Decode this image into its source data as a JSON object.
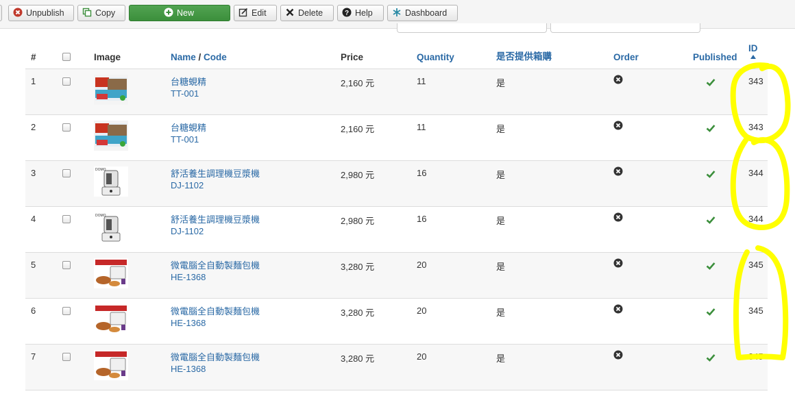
{
  "toolbar": {
    "unpublish": "Unpublish",
    "copy": "Copy",
    "new": "New",
    "edit": "Edit",
    "delete": "Delete",
    "help": "Help",
    "dashboard": "Dashboard"
  },
  "table": {
    "headers": {
      "num": "#",
      "image": "Image",
      "name": "Name",
      "sep": " / ",
      "code": "Code",
      "price": "Price",
      "quantity": "Quantity",
      "box": "是否提供箱購",
      "order": "Order",
      "published": "Published",
      "id": "ID"
    },
    "rows": [
      {
        "num": "1",
        "name": "台糖蜆精",
        "code": "TT-001",
        "price": "2,160 元",
        "quantity": "11",
        "box": "是",
        "id": "343",
        "image": "clam-essence-box"
      },
      {
        "num": "2",
        "name": "台糖蜆精",
        "code": "TT-001",
        "price": "2,160 元",
        "quantity": "11",
        "box": "是",
        "id": "343",
        "image": "clam-essence-box"
      },
      {
        "num": "3",
        "name": "舒活養生調理機豆漿機",
        "code": "DJ-1102",
        "price": "2,980 元",
        "quantity": "16",
        "box": "是",
        "id": "344",
        "image": "blender"
      },
      {
        "num": "4",
        "name": "舒活養生調理機豆漿機",
        "code": "DJ-1102",
        "price": "2,980 元",
        "quantity": "16",
        "box": "是",
        "id": "344",
        "image": "blender"
      },
      {
        "num": "5",
        "name": "微電腦全自動製麵包機",
        "code": "HE-1368",
        "price": "3,280 元",
        "quantity": "20",
        "box": "是",
        "id": "345",
        "image": "bread-maker"
      },
      {
        "num": "6",
        "name": "微電腦全自動製麵包機",
        "code": "HE-1368",
        "price": "3,280 元",
        "quantity": "20",
        "box": "是",
        "id": "345",
        "image": "bread-maker"
      },
      {
        "num": "7",
        "name": "微電腦全自動製麵包機",
        "code": "HE-1368",
        "price": "3,280 元",
        "quantity": "20",
        "box": "是",
        "id": "345",
        "image": "bread-maker"
      }
    ]
  },
  "colors": {
    "link": "#2a69a5",
    "new_button": "#46a046",
    "published_check": "#3c8f3c",
    "highlight": "#ffff00"
  },
  "icons": {
    "unpublish": "x-circle-icon",
    "copy": "copy-icon",
    "new": "plus-circle-icon",
    "edit": "edit-icon",
    "delete": "x-icon",
    "help": "question-icon",
    "dashboard": "asterisk-icon",
    "order": "x-circle-icon",
    "published": "check-icon",
    "sort": "sort-up-icon"
  }
}
